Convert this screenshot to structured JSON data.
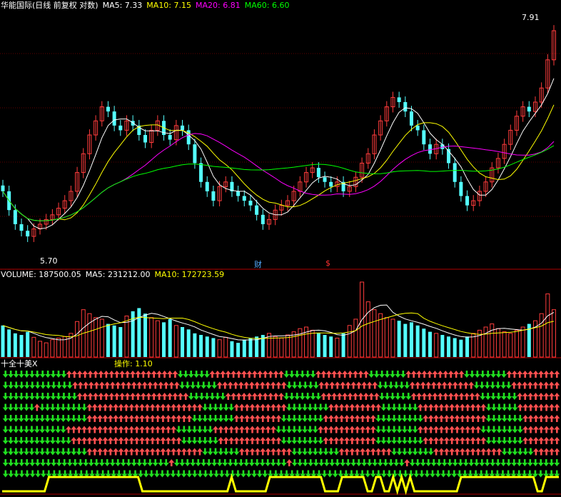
{
  "header": {
    "stock_name": "华能国际(日线 前复权 对数)",
    "ma5": "MA5: 7.33",
    "ma10": "MA10: 7.15",
    "ma20": "MA20: 6.81",
    "ma60": "MA60: 6.60"
  },
  "volume_header": {
    "volume": "VOLUME: 187500.05",
    "ma5": "MA5: 231212.00",
    "ma10": "MA10: 172723.59"
  },
  "indicator_header": {
    "name": "十全十美X",
    "op": "操作: 1.10"
  },
  "markers": {
    "high": "7.91",
    "low": "5.70",
    "cai": "财",
    "dollar": "$"
  },
  "colors": {
    "up": "#ff3c3c",
    "down": "#54ffff",
    "ma5": "#ffffff",
    "ma10": "#ffff00",
    "ma20": "#ff00ff",
    "ma60": "#00ff00",
    "arrow_up": "#ff5050",
    "arrow_down": "#20e020",
    "op_line": "#ffff00"
  },
  "chart_data": {
    "type": "candlestick",
    "ylim": [
      5.5,
      8.1
    ],
    "closes": [
      6.2,
      6.0,
      5.85,
      5.78,
      5.72,
      5.8,
      5.85,
      5.9,
      5.95,
      6.02,
      6.1,
      6.2,
      6.4,
      6.6,
      6.8,
      6.95,
      7.1,
      7.05,
      6.9,
      6.85,
      6.95,
      6.9,
      6.8,
      6.72,
      6.85,
      6.95,
      6.8,
      6.75,
      6.9,
      6.85,
      6.7,
      6.5,
      6.3,
      6.2,
      6.1,
      6.25,
      6.3,
      6.2,
      6.15,
      6.1,
      6.05,
      5.95,
      5.85,
      5.9,
      6.0,
      6.05,
      6.1,
      6.2,
      6.3,
      6.4,
      6.45,
      6.35,
      6.3,
      6.25,
      6.3,
      6.2,
      6.25,
      6.35,
      6.5,
      6.6,
      6.8,
      6.95,
      7.1,
      7.2,
      7.15,
      7.05,
      6.9,
      6.85,
      6.7,
      6.6,
      6.7,
      6.65,
      6.5,
      6.3,
      6.15,
      6.05,
      6.1,
      6.2,
      6.3,
      6.45,
      6.55,
      6.7,
      6.85,
      7.0,
      7.1,
      7.05,
      7.15,
      7.3,
      7.6,
      7.91
    ],
    "volumes": [
      40,
      35,
      30,
      28,
      32,
      25,
      20,
      18,
      22,
      24,
      26,
      30,
      45,
      60,
      55,
      50,
      48,
      42,
      40,
      38,
      52,
      58,
      62,
      55,
      50,
      46,
      44,
      48,
      40,
      38,
      35,
      30,
      28,
      26,
      24,
      22,
      25,
      20,
      18,
      22,
      24,
      26,
      28,
      30,
      26,
      24,
      28,
      32,
      36,
      38,
      34,
      30,
      28,
      26,
      24,
      30,
      40,
      48,
      95,
      70,
      60,
      55,
      50,
      48,
      46,
      42,
      44,
      40,
      36,
      32,
      30,
      28,
      26,
      24,
      22,
      26,
      30,
      34,
      38,
      42,
      36,
      32,
      30,
      34,
      38,
      42,
      46,
      55,
      80,
      60
    ],
    "volume_ma5": "231212.00",
    "volume_ma10": "172723.59"
  },
  "indicator_rows": [
    "DDDDDDDDDDDDUUUUUUUUUUUUUUUUUUUUUDDDDDDUUUUUUUUUUUUUUDDDDDDUUUUUUUUUUDDDDDDDUUUUUUUUUUUDDDDDDDDUUUUUUUUUU",
    "DDDDDDDDDDDDDUUUUUUUUUUUUUUUUUUUUDDDDDDDUUUUUUUUUUUUUDDDDDDUUUUUUUUUUUDDDDDDUUUUUUUUUUUUDDDDDDDUUUUUUUUU",
    "DDDDDDDDDDDDDDUUUUUUUUUUUUUUUUUUUUUDDDDDDDUUUUUUUUUUUDDDDDDDUUUUUUUUUUUDDDDDDUUUUUUUUUUUUUDDDDDDDUUUUUUUU",
    "DDDDDDUDDDDDDDDDUUUUUUUUUUUUUUUUUUUUUUDDDDDDUUUUUUUUUUDDDDDDDDUUUUUUUUUUDDDDDDDUUUUUUUUUUUUUDDDDDDUUUUUUUU",
    "DDDDDDDDDDDDDDDDUUUUUUUUUUUUUUUUUUUUDDDDDDDDUUUUUUUUUDDDDDDDDUUUUUUUUUUDDDDDDDDDUUUUUUUUUUUUDDDDDDDUUUUUUU",
    "DDDDDDDDDDDDUUUUUUUUUUUUUUUUUUUUUDDDDDDDUUUUUUUUUUUUDDDDDDDDUUUUUUUUUUUDDDDDDDDUUUUUUUUUUUUDDDDDDDDUUUUUUU",
    "DDDDDDDDDDDDDUUUUUUUUUUUUUUUUUUUUUDDDDDDDUUUUUUUUUUUUDDDDDDDDUUUUUUUUUUDDDDDDDDDUUUUUUUUUUUUDDDDDDDUUUUUUU",
    "DDDDDDDDDDDDDDDDUUUUUUUUUUUUUUUUUUUUUUDDDDDDDUUUUUUUUUUDDDDDDDDDUUUUUUUUUUDDDDDDDDUUUUUUUUUUUUUDDDDDDUUUUU",
    "DDDDDDDDDDDDDDDDDDDDDDDDDDDDDDDUDDDDDDDDDDDDDDDDDDDDDUDDDDDDDDDDDDDDDDDDDDDUDDDDDDDDDDDDDDDDDDDDDDDDDDDD",
    "DDDDDDDDDDDDDDDDDDDDDDDDDDDDDDDDDDDDDDDDDDDDDDDDDDDDDDDDDDDDDDDDDDDDDDDDDDDDDDDDDDDDDDDDDDDDDDDDDDDDDDD"
  ],
  "op_line": [
    0,
    0,
    0,
    0,
    0,
    0,
    0,
    0,
    0,
    0,
    0,
    1,
    1,
    1,
    1,
    1,
    1,
    1,
    1,
    1,
    1,
    1,
    1,
    1,
    1,
    1,
    1,
    1,
    1,
    1,
    1,
    1,
    1,
    0,
    0,
    0,
    0,
    0,
    0,
    0,
    0,
    0,
    0,
    0,
    0,
    0,
    0,
    0,
    0,
    0,
    0,
    0,
    0,
    0,
    1,
    0,
    0,
    0,
    0,
    0,
    0,
    0,
    0,
    1,
    1,
    1,
    1,
    1,
    1,
    1,
    1,
    1,
    1,
    1,
    1,
    1,
    0,
    0,
    0,
    0,
    1,
    1,
    1,
    1,
    1,
    1,
    0,
    0,
    1,
    1,
    0,
    0,
    1,
    0,
    1,
    0,
    1,
    0,
    0,
    0,
    0,
    0,
    0,
    0,
    0,
    0,
    0,
    0,
    1,
    1,
    1,
    1,
    1,
    1,
    1,
    1,
    1,
    1,
    1,
    1,
    1,
    1,
    1,
    1,
    1,
    1,
    0,
    0,
    1,
    1,
    1,
    1
  ]
}
